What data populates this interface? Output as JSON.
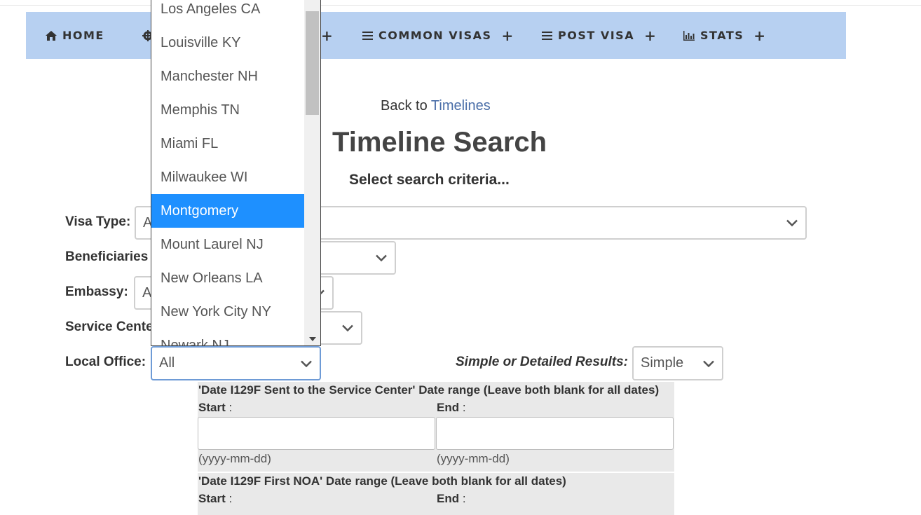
{
  "nav": {
    "home": "HOME",
    "hidden_item": "",
    "common_visas": "COMMON VISAS",
    "post_visa": "POST VISA",
    "stats": "STATS",
    "plus": "+"
  },
  "page": {
    "back_prefix": "Back to",
    "back_link": "Timelines",
    "title": "Timeline Search",
    "subtitle": "Select search criteria..."
  },
  "form": {
    "visa_type_label": "Visa Type:",
    "visa_type_value": "A",
    "beneficiaries_label": "Beneficiaries",
    "embassy_label": "Embassy:",
    "embassy_value": "A",
    "service_center_label": "Service Cente",
    "local_office_label": "Local Office:",
    "local_office_value": "All",
    "results_label": "Simple or Detailed Results:",
    "results_value": "Simple"
  },
  "dropdown": {
    "options": [
      "Los Angeles CA",
      "Louisville KY",
      "Manchester NH",
      "Memphis TN",
      "Miami FL",
      "Milwaukee WI",
      "Montgomery",
      "Mount Laurel NJ",
      "New Orleans LA",
      "New York City NY",
      "Newark NJ"
    ],
    "selected": "Montgomery"
  },
  "date_ranges": [
    {
      "title": "'Date I129F Sent to the Service Center' Date range (Leave both blank for all dates)",
      "start": "Start",
      "end": "End",
      "colon": " :",
      "hint": "(yyyy-mm-dd)"
    },
    {
      "title": "'Date I129F First NOA' Date range (Leave both blank for all dates)",
      "start": "Start",
      "end": "End",
      "colon": " :",
      "hint": "(yyyy-mm-dd)"
    }
  ],
  "colors": {
    "nav_bg": "#b7d0f1",
    "link": "#4a6ea8",
    "selected_option": "#1e90ff"
  }
}
